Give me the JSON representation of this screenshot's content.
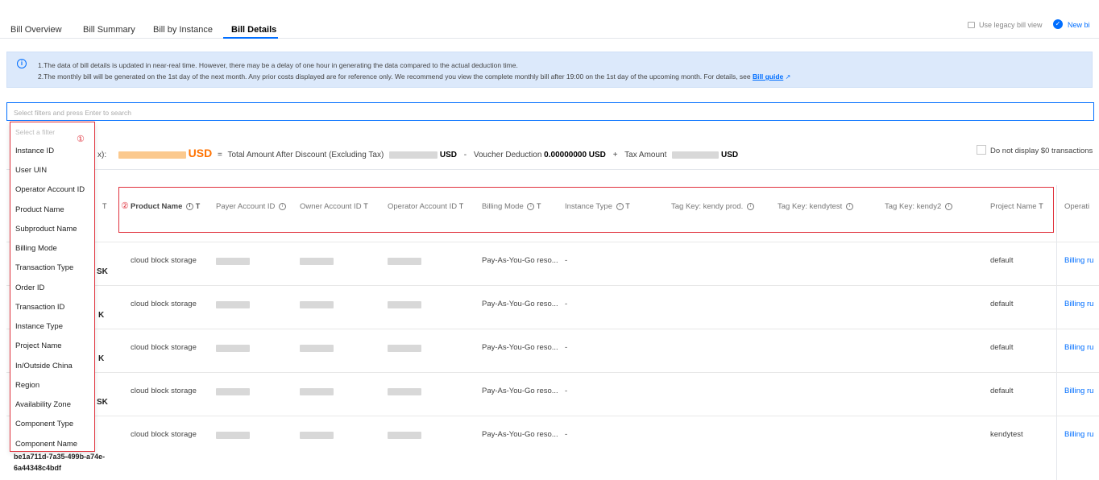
{
  "tabs": [
    {
      "label": "Bill Overview",
      "active": false
    },
    {
      "label": "Bill Summary",
      "active": false
    },
    {
      "label": "Bill by Instance",
      "active": false
    },
    {
      "label": "Bill Details",
      "active": true
    }
  ],
  "top_actions": {
    "legacy_label": "Use legacy bill view",
    "new_bill_label": "New bi"
  },
  "banner": {
    "line1": "1.The data of bill details is updated in near-real time. However, there may be a delay of one hour in generating the data compared to the actual deduction time.",
    "line2": "2.The monthly bill will be generated on the 1st day of the next month. Any prior costs displayed are for reference only. We recommend you view the complete monthly bill after 19:00 on the 1st day of the upcoming month. For details, see",
    "link": "Bill guide"
  },
  "search": {
    "placeholder": "Select filters and press Enter to search"
  },
  "summary": {
    "prefix": "x):",
    "currency": "USD",
    "eq": "=",
    "total_label": "Total Amount After Discount (Excluding Tax)",
    "minus": "-",
    "voucher_label": "Voucher Deduction",
    "voucher_value": "0.00000000 USD",
    "plus": "+",
    "tax_label": "Tax Amount",
    "usd": "USD",
    "checkbox_label": "Do not display $0 transactions"
  },
  "filter_menu": {
    "header": "Select a filter",
    "marker": "①",
    "items": [
      "Instance ID",
      "User UIN",
      "Operator Account ID",
      "Product Name",
      "Subproduct Name",
      "Billing Mode",
      "Transaction Type",
      "Order ID",
      "Transaction ID",
      "Instance Type",
      "Project Name",
      "In/Outside China",
      "Region",
      "Availability Zone",
      "Component Type",
      "Component Name"
    ]
  },
  "table": {
    "marker": "②",
    "filter_glyph": "T",
    "info_glyph": "i",
    "headers": {
      "product": "Product Name",
      "payer": "Payer Account ID",
      "owner": "Owner Account ID",
      "operator": "Operator Account ID",
      "billing_mode": "Billing Mode",
      "instance_type": "Instance Type",
      "tag1": "Tag Key: kendy prod.",
      "tag2": "Tag Key: kendytest",
      "tag3": "Tag Key: kendy2",
      "project": "Project Name",
      "operation": "Operati"
    },
    "rows": [
      {
        "left_frag": "SK",
        "product": "cloud block storage",
        "billing": "Pay-As-You-Go reso...",
        "instance_type": "-",
        "project": "default",
        "op": "Billing ru"
      },
      {
        "left_frag": "K",
        "product": "cloud block storage",
        "billing": "Pay-As-You-Go reso...",
        "instance_type": "-",
        "project": "default",
        "op": "Billing ru"
      },
      {
        "left_frag": "K",
        "product": "cloud block storage",
        "billing": "Pay-As-You-Go reso...",
        "instance_type": "-",
        "project": "default",
        "op": "Billing ru"
      },
      {
        "left_frag": "SK",
        "product": "cloud block storage",
        "billing": "Pay-As-You-Go reso...",
        "instance_type": "-",
        "project": "default",
        "op": "Billing ru"
      },
      {
        "left_frag": "",
        "product": "cloud block storage",
        "billing": "Pay-As-You-Go reso...",
        "instance_type": "-",
        "project": "kendytest",
        "op": "Billing ru"
      }
    ],
    "last_instance_id_line1": "be1a711d-7a35-499b-a74e-",
    "last_instance_id_line2": "6a44348c4bdf"
  }
}
